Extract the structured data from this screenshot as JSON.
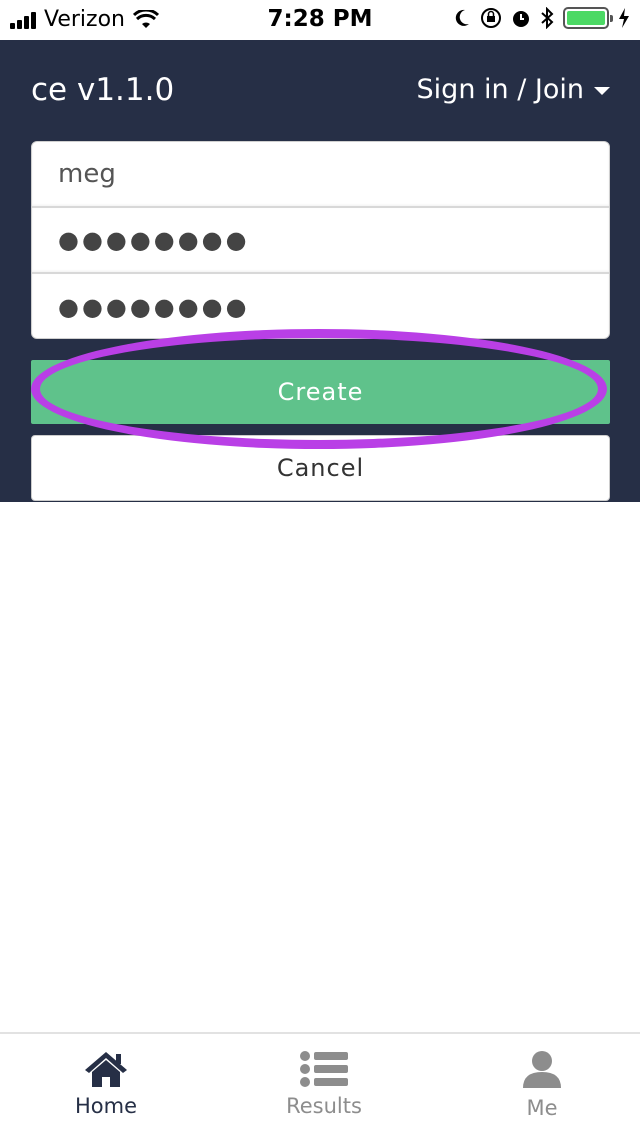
{
  "status_bar": {
    "carrier": "Verizon",
    "time": "7:28 PM"
  },
  "header": {
    "app_title": "ce v1.1.0",
    "auth_menu_label": "Sign in / Join"
  },
  "form": {
    "username_value": "meg",
    "password_value": "●●●●●●●●",
    "confirm_password_value": "●●●●●●●●"
  },
  "buttons": {
    "create_label": "Create",
    "cancel_label": "Cancel"
  },
  "tabbar": {
    "tabs": [
      {
        "label": "Home",
        "icon": "home-icon",
        "active": true
      },
      {
        "label": "Results",
        "icon": "list-icon",
        "active": false
      },
      {
        "label": "Me",
        "icon": "user-icon",
        "active": false
      }
    ]
  },
  "colors": {
    "header_bg": "#262f46",
    "create_button": "#5fc28b",
    "highlight": "#b93fe6",
    "battery": "#4cd964"
  }
}
